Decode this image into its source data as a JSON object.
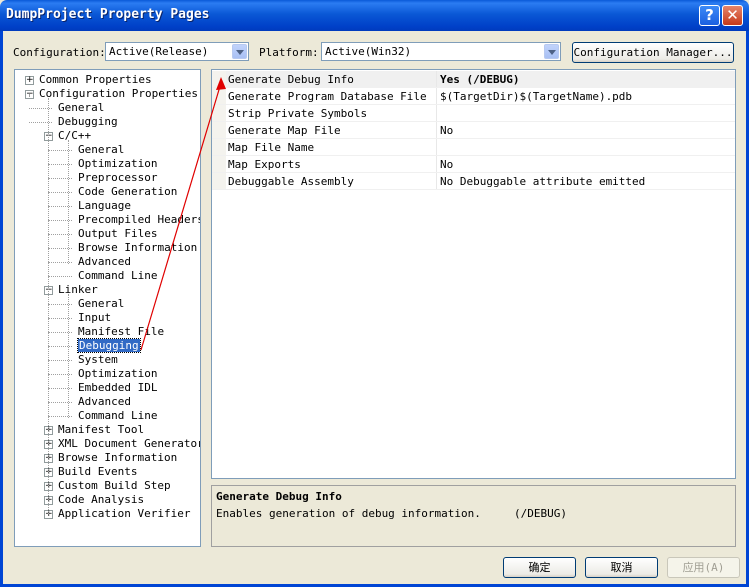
{
  "window": {
    "title": "DumpProject Property Pages",
    "help_glyph": "?",
    "close_glyph": "✕"
  },
  "config": {
    "configuration_label": "Configuration:",
    "configuration_value": "Active(Release)",
    "platform_label": "Platform:",
    "platform_value": "Active(Win32)",
    "manager_button": "Configuration Manager..."
  },
  "tree": {
    "items": [
      {
        "label": "Common Properties",
        "level": 0,
        "expander": "+"
      },
      {
        "label": "Configuration Properties",
        "level": 0,
        "expander": "−"
      },
      {
        "label": "General",
        "level": 1
      },
      {
        "label": "Debugging",
        "level": 1
      },
      {
        "label": "C/C++",
        "level": 1,
        "expander": "−"
      },
      {
        "label": "General",
        "level": 2
      },
      {
        "label": "Optimization",
        "level": 2
      },
      {
        "label": "Preprocessor",
        "level": 2
      },
      {
        "label": "Code Generation",
        "level": 2
      },
      {
        "label": "Language",
        "level": 2
      },
      {
        "label": "Precompiled Headers",
        "level": 2
      },
      {
        "label": "Output Files",
        "level": 2
      },
      {
        "label": "Browse Information",
        "level": 2
      },
      {
        "label": "Advanced",
        "level": 2
      },
      {
        "label": "Command Line",
        "level": 2
      },
      {
        "label": "Linker",
        "level": 1,
        "expander": "−"
      },
      {
        "label": "General",
        "level": 2
      },
      {
        "label": "Input",
        "level": 2
      },
      {
        "label": "Manifest File",
        "level": 2
      },
      {
        "label": "Debugging",
        "level": 2,
        "selected": true
      },
      {
        "label": "System",
        "level": 2
      },
      {
        "label": "Optimization",
        "level": 2
      },
      {
        "label": "Embedded IDL",
        "level": 2
      },
      {
        "label": "Advanced",
        "level": 2
      },
      {
        "label": "Command Line",
        "level": 2
      },
      {
        "label": "Manifest Tool",
        "level": 1,
        "expander": "+"
      },
      {
        "label": "XML Document Generator",
        "level": 1,
        "expander": "+"
      },
      {
        "label": "Browse Information",
        "level": 1,
        "expander": "+"
      },
      {
        "label": "Build Events",
        "level": 1,
        "expander": "+"
      },
      {
        "label": "Custom Build Step",
        "level": 1,
        "expander": "+"
      },
      {
        "label": "Code Analysis",
        "level": 1,
        "expander": "+"
      },
      {
        "label": "Application Verifier",
        "level": 1,
        "expander": "+"
      }
    ]
  },
  "grid": {
    "rows": [
      {
        "name": "Generate Debug Info",
        "value": "Yes (/DEBUG)",
        "selected": true
      },
      {
        "name": "Generate Program Database File",
        "value": "$(TargetDir)$(TargetName).pdb"
      },
      {
        "name": "Strip Private Symbols",
        "value": ""
      },
      {
        "name": "Generate Map File",
        "value": "No"
      },
      {
        "name": "Map File Name",
        "value": ""
      },
      {
        "name": "Map Exports",
        "value": "No"
      },
      {
        "name": "Debuggable Assembly",
        "value": "No Debuggable attribute emitted"
      }
    ]
  },
  "description": {
    "title": "Generate Debug Info",
    "text": "Enables generation of debug information.     (/DEBUG)"
  },
  "buttons": {
    "ok": "确定",
    "cancel": "取消",
    "apply": "应用(A)"
  },
  "annotation": {
    "color": "#e00000"
  }
}
